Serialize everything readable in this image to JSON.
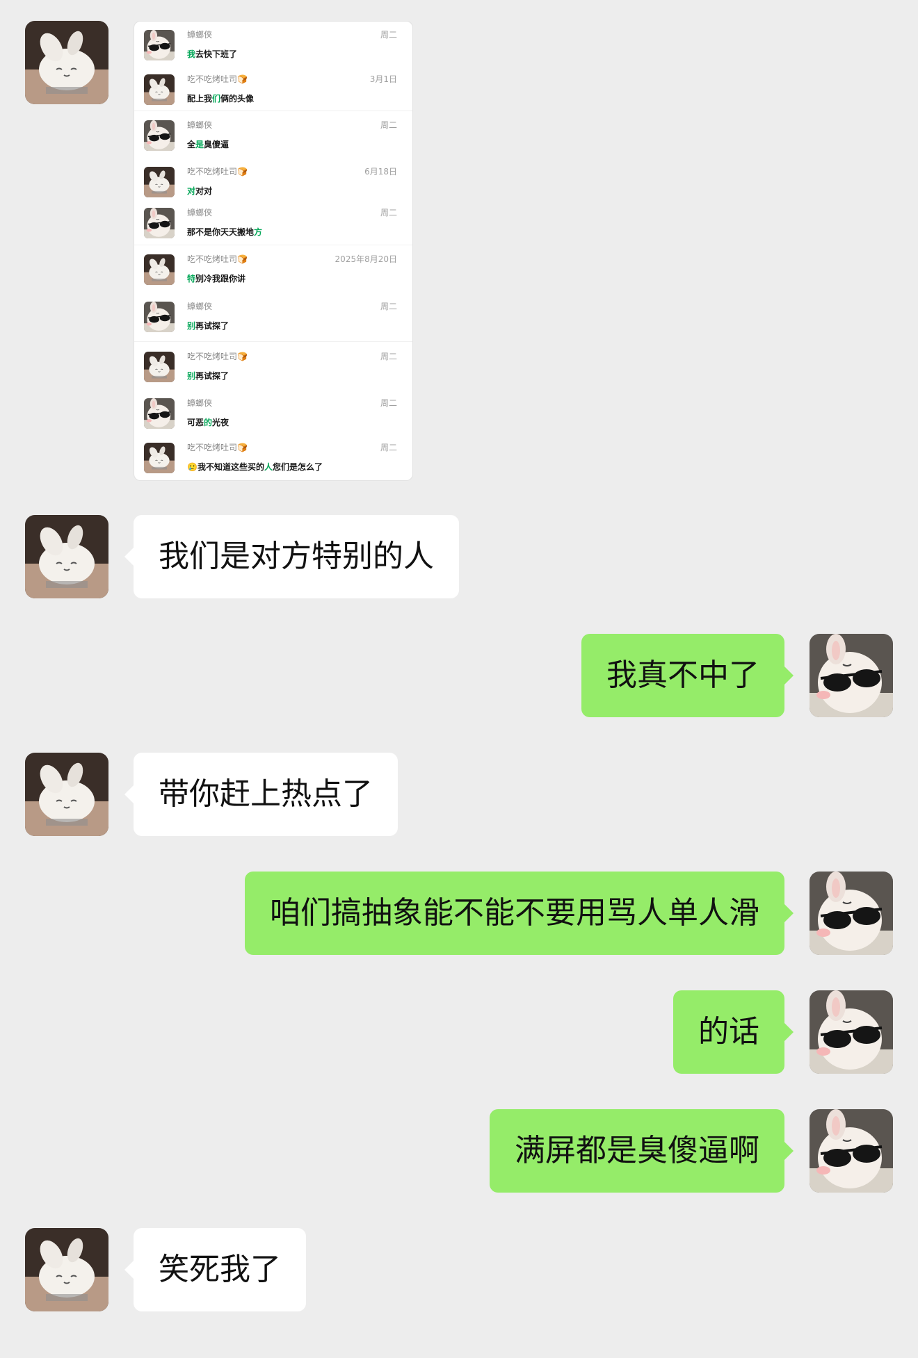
{
  "screenshot": {
    "rows": [
      {
        "sender": "蟑螂侠",
        "time": "周二",
        "pre": "",
        "hl": "我",
        "post": "去快下班了",
        "avatar": "sunglasses"
      },
      {
        "sender": "吃不吃烤吐司🍞",
        "time": "3月1日",
        "pre": "配上我",
        "hl": "们",
        "post": "俩的头像",
        "avatar": "bunny"
      },
      {
        "sender": "蟑螂侠",
        "time": "周二",
        "pre": "全",
        "hl": "是",
        "post": "臭傻逼",
        "avatar": "sunglasses"
      },
      {
        "sender": "吃不吃烤吐司🍞",
        "time": "6月18日",
        "pre": "",
        "hl": "对",
        "post": "对对",
        "avatar": "bunny"
      },
      {
        "sender": "蟑螂侠",
        "time": "周二",
        "pre": "那不是你天天搬地",
        "hl": "方",
        "post": "",
        "avatar": "sunglasses"
      },
      {
        "sender": "吃不吃烤吐司🍞",
        "time": "2025年8月20日",
        "pre": "",
        "hl": "特",
        "post": "别冷我跟你讲",
        "avatar": "bunny"
      },
      {
        "sender": "蟑螂侠",
        "time": "周二",
        "pre": "",
        "hl": "别",
        "post": "再试探了",
        "avatar": "sunglasses"
      },
      {
        "sender": "吃不吃烤吐司🍞",
        "time": "周二",
        "pre": "",
        "hl": "别",
        "post": "再试探了",
        "avatar": "bunny"
      },
      {
        "sender": "蟑螂侠",
        "time": "周二",
        "pre": "可恶",
        "hl": "的",
        "post": "光夜",
        "avatar": "sunglasses"
      },
      {
        "sender": "吃不吃烤吐司🍞",
        "time": "周二",
        "pre": "🥲我不知道这些买的",
        "hl": "人",
        "post": "您们是怎么了",
        "avatar": "bunny"
      }
    ]
  },
  "messages": [
    {
      "side": "in",
      "text": "我们是对方特别的人"
    },
    {
      "side": "out",
      "text": "我真不中了"
    },
    {
      "side": "in",
      "text": "带你赶上热点了"
    },
    {
      "side": "out",
      "text": "咱们搞抽象能不能不要用骂人单人滑"
    },
    {
      "side": "out",
      "text": "的话"
    },
    {
      "side": "out",
      "text": "满屏都是臭傻逼啊"
    },
    {
      "side": "in",
      "text": "笑死我了"
    }
  ],
  "colors": {
    "background": "#ededed",
    "incoming_bubble": "#ffffff",
    "outgoing_bubble": "#95ec69",
    "highlight_text": "#07a85a"
  },
  "icons": {
    "left_avatar": "bunny-avatar-icon",
    "right_avatar": "sunglasses-bunny-avatar-icon"
  }
}
